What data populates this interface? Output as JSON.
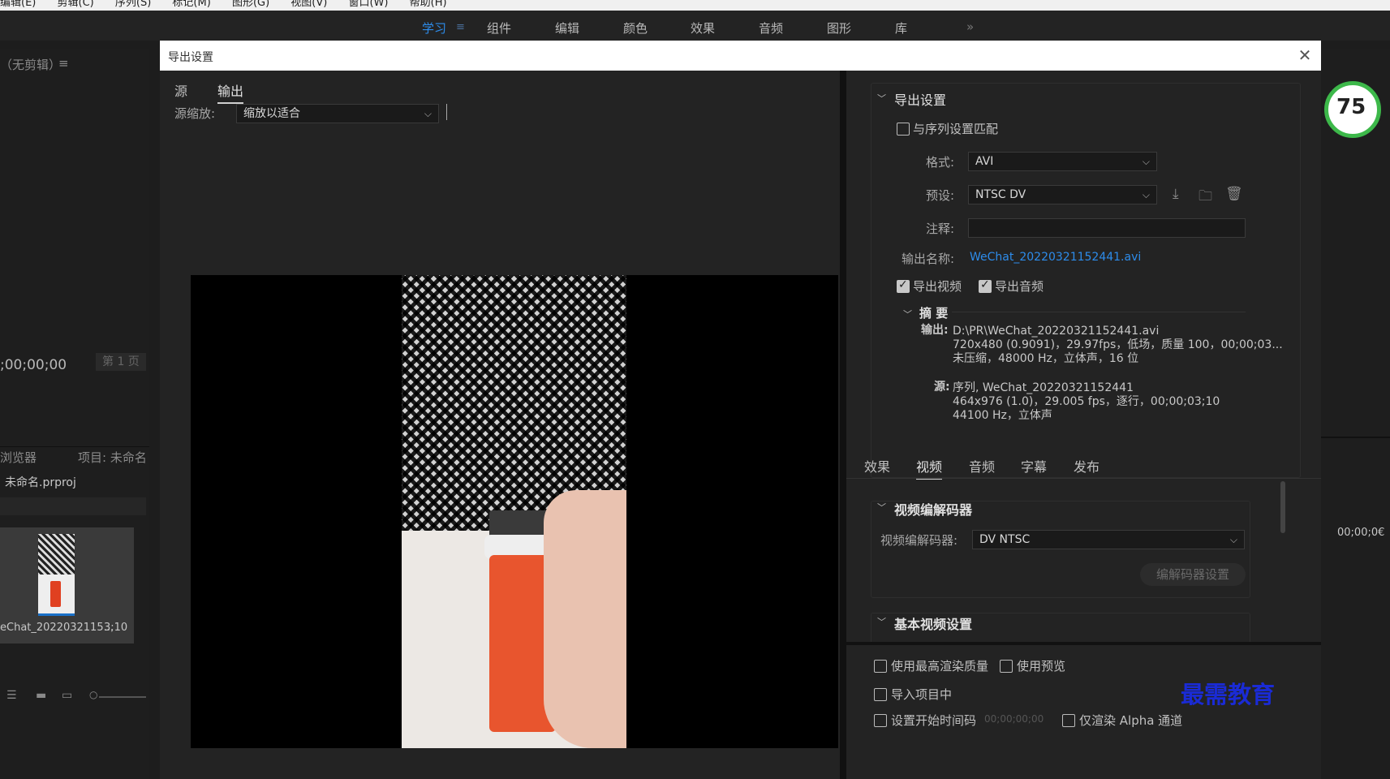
{
  "menu": [
    "编辑(E)",
    "剪辑(C)",
    "序列(S)",
    "标记(M)",
    "图形(G)",
    "视图(V)",
    "窗口(W)",
    "帮助(H)"
  ],
  "workspaces": {
    "tabs": [
      "学习",
      "组件",
      "编辑",
      "颜色",
      "效果",
      "音频",
      "图形",
      "库"
    ],
    "active": "学习",
    "menu_icon": "≡",
    "overflow": "»"
  },
  "background": {
    "source_monitor_title": "（无剪辑）",
    "source_monitor_menu": "≡",
    "timecode": ";00;00;00",
    "page": "第 1 页",
    "browser_tab": "浏览器",
    "project_tab": "项目: 未命名",
    "project_file": "未命名.prproj",
    "clip_name": "eChat_2022032115...",
    "clip_duration": "3;10",
    "right_timecode": "00;00;0€",
    "progress_badge": "75"
  },
  "dialog": {
    "title": "导出设置",
    "left": {
      "tabs": [
        "源",
        "输出"
      ],
      "active_tab": "输出",
      "scale_label": "源缩放:",
      "scale_value": "缩放以适合"
    },
    "export_settings": {
      "section_title": "导出设置",
      "match_sequence_label": "与序列设置匹配",
      "match_sequence_checked": false,
      "format_label": "格式:",
      "format_value": "AVI",
      "preset_label": "预设:",
      "preset_value": "NTSC DV",
      "comment_label": "注释:",
      "comment_value": "",
      "output_name_label": "输出名称:",
      "output_name_value": "WeChat_20220321152441.avi",
      "export_video_label": "导出视频",
      "export_video_checked": true,
      "export_audio_label": "导出音频",
      "export_audio_checked": true
    },
    "summary": {
      "title": "摘 要",
      "output_label": "输出:",
      "output_lines": [
        "D:\\PR\\WeChat_20220321152441.avi",
        "720x480 (0.9091)，29.97fps，低场，质量 100，00;00;03...",
        "未压缩，48000 Hz，立体声，16 位"
      ],
      "source_label": "源:",
      "source_lines": [
        "序列, WeChat_20220321152441",
        "464x976 (1.0)，29.005 fps，逐行，00;00;03;10",
        "44100 Hz，立体声"
      ]
    },
    "settings_tabs": [
      "效果",
      "视频",
      "音频",
      "字幕",
      "发布"
    ],
    "settings_active": "视频",
    "video_codec": {
      "section_title": "视频编解码器",
      "codec_label": "视频编解码器:",
      "codec_value": "DV NTSC",
      "codec_settings_button": "编解码器设置"
    },
    "basic_video": {
      "section_title": "基本视频设置"
    },
    "bottom": {
      "max_render_quality": "使用最高渲染质量",
      "use_previews": "使用预览",
      "import_into_project": "导入项目中",
      "set_start_timecode": "设置开始时间码",
      "start_timecode_value": "00;00;00;00",
      "render_alpha_only": "仅渲染 Alpha 通道"
    }
  },
  "watermark": "最需教育"
}
